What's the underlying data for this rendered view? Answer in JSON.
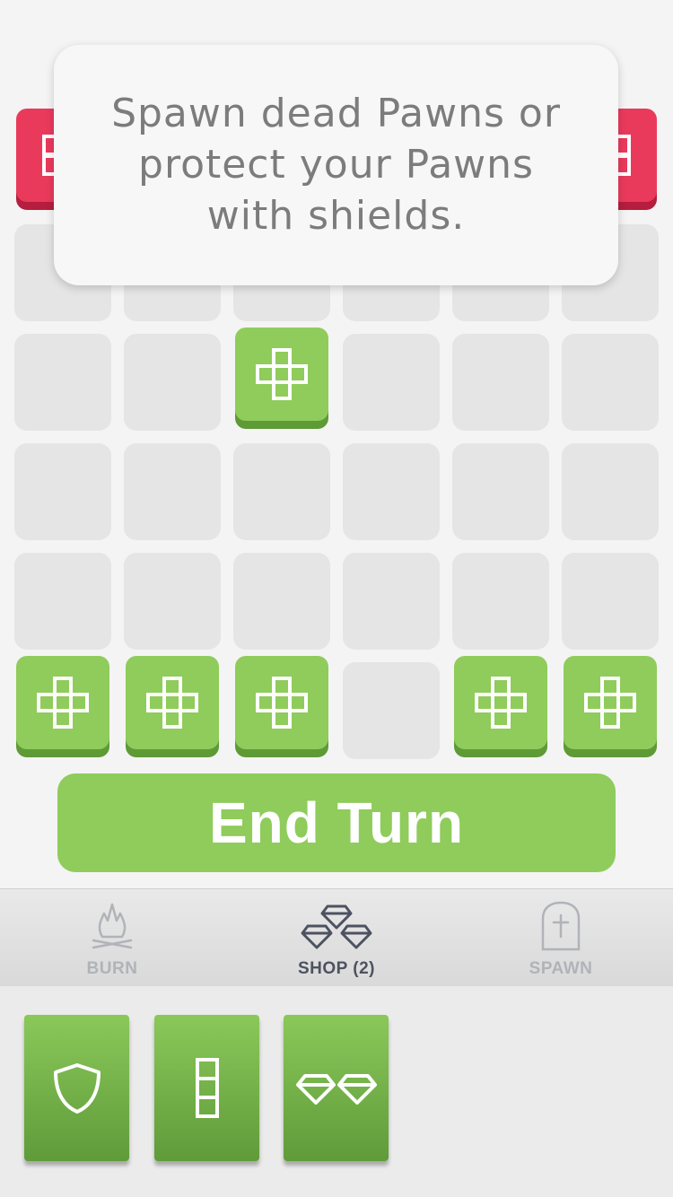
{
  "tooltip": {
    "text": "Spawn dead Pawns or\nprotect your Pawns\nwith shields."
  },
  "board": {
    "columns": 6,
    "rows": 6,
    "colors": {
      "empty": "#e5e5e5",
      "pawn": "#8fcc5b",
      "enemy": "#ea3a5c"
    },
    "pieces": [
      {
        "type": "enemy",
        "row": 0,
        "col": 0
      },
      {
        "type": "enemy",
        "row": 0,
        "col": 5
      },
      {
        "type": "pawn",
        "row": 2,
        "col": 2
      },
      {
        "type": "pawn",
        "row": 5,
        "col": 0
      },
      {
        "type": "pawn",
        "row": 5,
        "col": 1
      },
      {
        "type": "pawn",
        "row": 5,
        "col": 2
      },
      {
        "type": "pawn",
        "row": 5,
        "col": 4
      },
      {
        "type": "pawn",
        "row": 5,
        "col": 5
      }
    ]
  },
  "end_turn": {
    "label": "End Turn"
  },
  "tabs": [
    {
      "label": "BURN",
      "icon": "fire-icon",
      "active": false
    },
    {
      "label": "SHOP (2)",
      "icon": "gems-icon",
      "active": true
    },
    {
      "label": "SPAWN",
      "icon": "tombstone-icon",
      "active": false
    }
  ],
  "cards": [
    {
      "icon": "shield-icon"
    },
    {
      "icon": "column-blocks-icon"
    },
    {
      "icon": "diamonds-icon"
    }
  ]
}
